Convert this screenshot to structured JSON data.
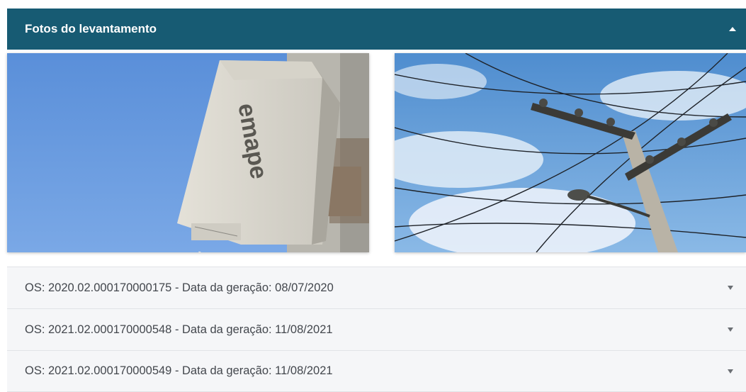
{
  "panel": {
    "title": "Fotos do levantamento",
    "toggle_icon": "caret-up-icon",
    "header_color": "#175b73"
  },
  "photos": [
    {
      "name": "meter-box-photo",
      "label_text": "emape"
    },
    {
      "name": "utility-pole-photo"
    }
  ],
  "orders": [
    {
      "label": "OS: 2020.02.000170000175 - Data da geração: 08/07/2020",
      "icon": "caret-down-icon"
    },
    {
      "label": "OS: 2021.02.000170000548 - Data da geração: 11/08/2021",
      "icon": "caret-down-icon"
    },
    {
      "label": "OS: 2021.02.000170000549 - Data da geração: 11/08/2021",
      "icon": "caret-down-icon"
    }
  ]
}
